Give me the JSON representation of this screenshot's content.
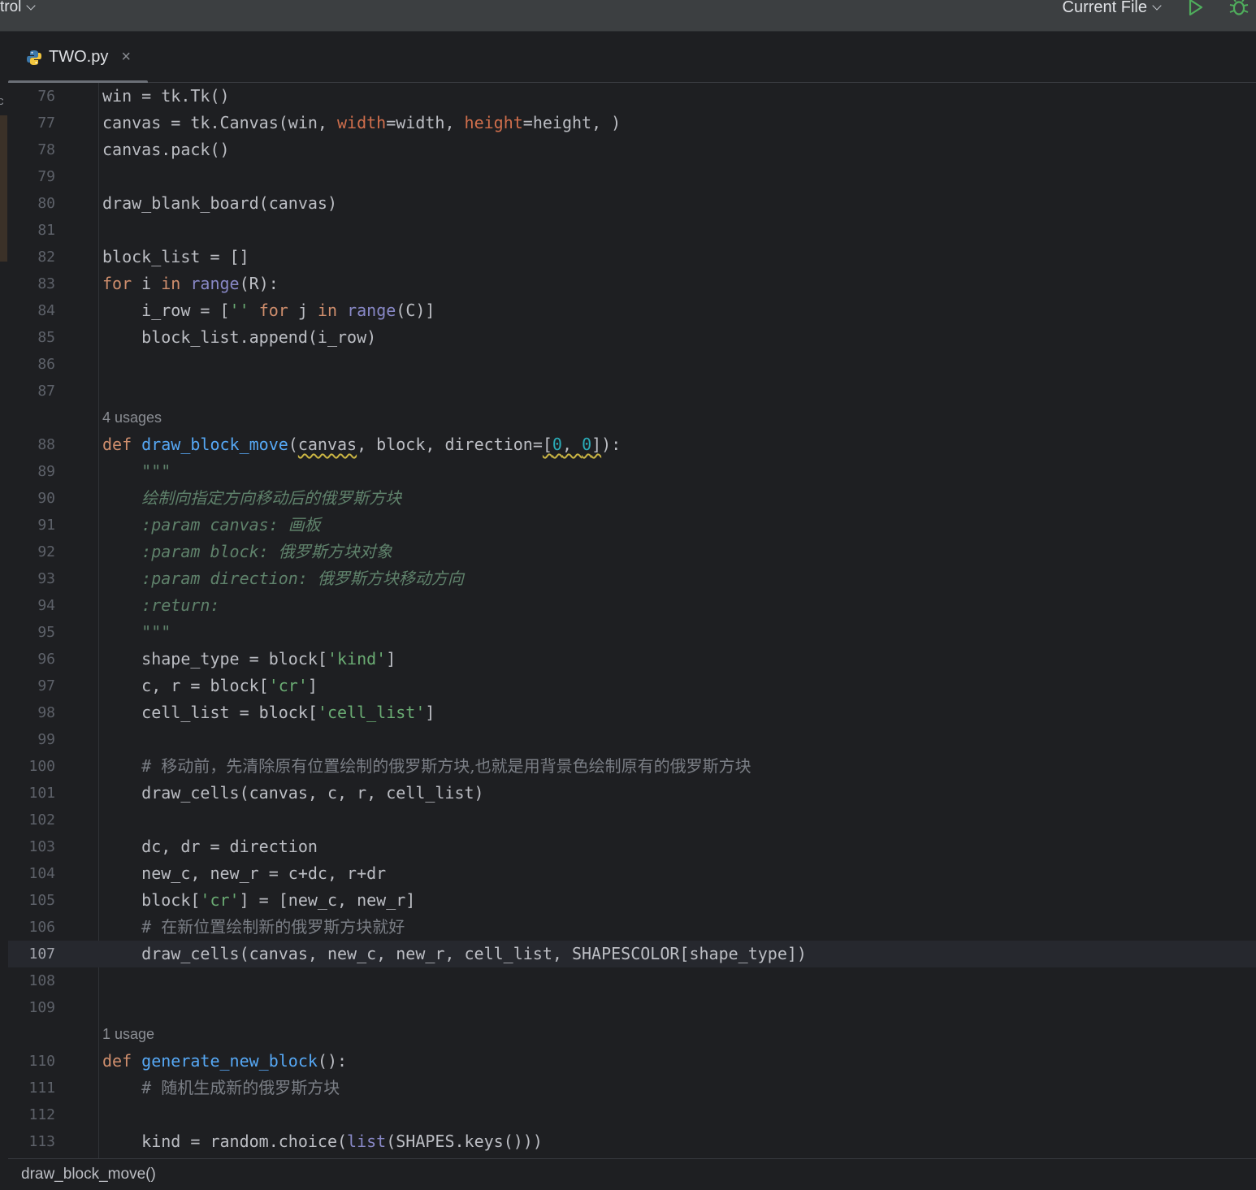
{
  "toolbar": {
    "left_label": "trol",
    "run_config": "Current File",
    "run_color": "#4fae5c",
    "debug_color": "#4fae5c"
  },
  "tab": {
    "filename": "TWO.py",
    "close": "×"
  },
  "left_strip_letter": "c",
  "editor": {
    "lines": [
      {
        "n": "76",
        "tokens": [
          [
            "win = tk.Tk()",
            ""
          ]
        ]
      },
      {
        "n": "77",
        "tokens": [
          [
            "canvas = tk.Canvas(win, ",
            ""
          ],
          [
            "width",
            "param"
          ],
          [
            "=width, ",
            ""
          ],
          [
            "height",
            "param"
          ],
          [
            "=height, )",
            ""
          ]
        ]
      },
      {
        "n": "78",
        "tokens": [
          [
            "canvas.pack()",
            ""
          ]
        ]
      },
      {
        "n": "79",
        "tokens": []
      },
      {
        "n": "80",
        "tokens": [
          [
            "draw_blank_board(canvas)",
            ""
          ]
        ]
      },
      {
        "n": "81",
        "tokens": []
      },
      {
        "n": "82",
        "tokens": [
          [
            "block_list = []",
            ""
          ]
        ]
      },
      {
        "n": "83",
        "tokens": [
          [
            "for",
            "kw"
          ],
          [
            " i ",
            ""
          ],
          [
            "in",
            "kw"
          ],
          [
            " ",
            ""
          ],
          [
            "range",
            "bi"
          ],
          [
            "(R):",
            ""
          ]
        ]
      },
      {
        "n": "84",
        "tokens": [
          [
            "    i_row = [",
            ""
          ],
          [
            "''",
            "str"
          ],
          [
            " ",
            ""
          ],
          [
            "for",
            "kw"
          ],
          [
            " j ",
            ""
          ],
          [
            "in",
            "kw"
          ],
          [
            " ",
            ""
          ],
          [
            "range",
            "bi"
          ],
          [
            "(C)]",
            ""
          ]
        ]
      },
      {
        "n": "85",
        "tokens": [
          [
            "    block_list.append(i_row)",
            ""
          ]
        ]
      },
      {
        "n": "86",
        "tokens": []
      },
      {
        "n": "87",
        "tokens": []
      },
      {
        "inlay": "4 usages"
      },
      {
        "n": "88",
        "tokens": [
          [
            "def",
            "kw"
          ],
          [
            " ",
            ""
          ],
          [
            "draw_block_move",
            "fn"
          ],
          [
            "(",
            ""
          ],
          [
            "canvas",
            "warn"
          ],
          [
            ", block, direction=",
            ""
          ],
          [
            "[",
            "warn"
          ],
          [
            "0",
            "num warn"
          ],
          [
            ", ",
            "warn"
          ],
          [
            "0",
            "num warn"
          ],
          [
            "]",
            "warn"
          ],
          [
            "):",
            ""
          ]
        ]
      },
      {
        "n": "89",
        "tokens": [
          [
            "    ",
            ""
          ],
          [
            "\"\"\"",
            "doc"
          ]
        ]
      },
      {
        "n": "90",
        "tokens": [
          [
            "    ",
            ""
          ],
          [
            "绘制向指定方向移动后的俄罗斯方块",
            "doc cjk"
          ]
        ]
      },
      {
        "n": "91",
        "tokens": [
          [
            "    ",
            ""
          ],
          [
            ":param",
            "doc-tag"
          ],
          [
            " canvas: ",
            "doc"
          ],
          [
            "画板",
            "doc cjk"
          ]
        ]
      },
      {
        "n": "92",
        "tokens": [
          [
            "    ",
            ""
          ],
          [
            ":param",
            "doc-tag"
          ],
          [
            " block: ",
            "doc"
          ],
          [
            "俄罗斯方块对象",
            "doc cjk"
          ]
        ]
      },
      {
        "n": "93",
        "tokens": [
          [
            "    ",
            ""
          ],
          [
            ":param",
            "doc-tag"
          ],
          [
            " direction: ",
            "doc"
          ],
          [
            "俄罗斯方块移动方向",
            "doc cjk"
          ]
        ]
      },
      {
        "n": "94",
        "tokens": [
          [
            "    ",
            ""
          ],
          [
            ":return:",
            "doc-tag"
          ]
        ]
      },
      {
        "n": "95",
        "tokens": [
          [
            "    ",
            ""
          ],
          [
            "\"\"\"",
            "doc"
          ]
        ]
      },
      {
        "n": "96",
        "tokens": [
          [
            "    shape_type = block[",
            ""
          ],
          [
            "'kind'",
            "str"
          ],
          [
            "]",
            ""
          ]
        ]
      },
      {
        "n": "97",
        "tokens": [
          [
            "    c, r = block[",
            ""
          ],
          [
            "'cr'",
            "str"
          ],
          [
            "]",
            ""
          ]
        ]
      },
      {
        "n": "98",
        "tokens": [
          [
            "    cell_list = block[",
            ""
          ],
          [
            "'cell_list'",
            "str"
          ],
          [
            "]",
            ""
          ]
        ]
      },
      {
        "n": "99",
        "tokens": []
      },
      {
        "n": "100",
        "tokens": [
          [
            "    ",
            ""
          ],
          [
            "# ",
            "cmt"
          ],
          [
            "移动前，先清除原有位置绘制的俄罗斯方块,也就是用背景色绘制原有的俄罗斯方块",
            "cmt cjk"
          ]
        ]
      },
      {
        "n": "101",
        "tokens": [
          [
            "    draw_cells(canvas, c, r, cell_list)",
            ""
          ]
        ]
      },
      {
        "n": "102",
        "tokens": []
      },
      {
        "n": "103",
        "tokens": [
          [
            "    dc, dr = direction",
            ""
          ]
        ]
      },
      {
        "n": "104",
        "tokens": [
          [
            "    new_c, new_r = c+dc, r+dr",
            ""
          ]
        ]
      },
      {
        "n": "105",
        "tokens": [
          [
            "    block[",
            ""
          ],
          [
            "'cr'",
            "str"
          ],
          [
            "] = [new_c, new_r]",
            ""
          ]
        ]
      },
      {
        "n": "106",
        "tokens": [
          [
            "    ",
            ""
          ],
          [
            "# ",
            "cmt"
          ],
          [
            "在新位置绘制新的俄罗斯方块就好",
            "cmt cjk"
          ]
        ]
      },
      {
        "n": "107",
        "current": true,
        "tokens": [
          [
            "    draw_cells(canvas, new_c, new_r, cell_list, SHAPESCOLOR[shape_type])",
            ""
          ]
        ]
      },
      {
        "n": "108",
        "tokens": []
      },
      {
        "n": "109",
        "tokens": []
      },
      {
        "inlay": "1 usage"
      },
      {
        "n": "110",
        "tokens": [
          [
            "def",
            "kw"
          ],
          [
            " ",
            ""
          ],
          [
            "generate_new_block",
            "fn"
          ],
          [
            "():",
            ""
          ]
        ]
      },
      {
        "n": "111",
        "tokens": [
          [
            "    ",
            ""
          ],
          [
            "# ",
            "cmt"
          ],
          [
            "随机生成新的俄罗斯方块",
            "cmt cjk"
          ]
        ]
      },
      {
        "n": "112",
        "tokens": []
      },
      {
        "n": "113",
        "tokens": [
          [
            "    kind = random.choice(",
            ""
          ],
          [
            "list",
            "bi"
          ],
          [
            "(SHAPES.keys()))",
            ""
          ]
        ]
      }
    ]
  },
  "status": {
    "breadcrumb": "draw_block_move()"
  }
}
